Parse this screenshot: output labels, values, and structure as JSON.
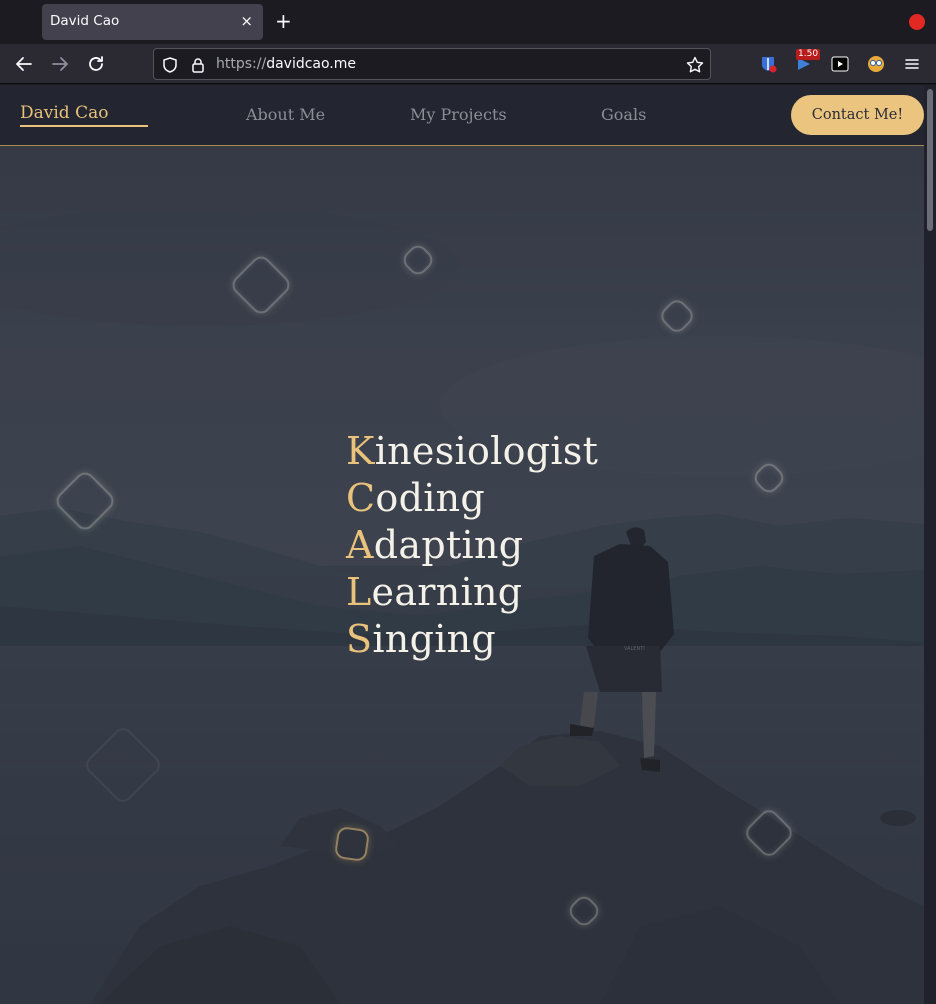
{
  "browser": {
    "tab_title": "David Cao",
    "tab_close": "×",
    "new_tab": "+",
    "url_scheme": "https://",
    "url_host": "davidcao.me",
    "extension_badge": "1.50",
    "icons": [
      "back-icon",
      "forward-icon",
      "reload-icon",
      "shield-icon",
      "lock-icon",
      "star-icon",
      "bitwarden-icon",
      "ublock-icon",
      "youtube-icon",
      "face-icon",
      "menu-icon"
    ]
  },
  "site": {
    "brand": "David Cao",
    "nav": [
      "About Me",
      "My Projects",
      "Goals"
    ],
    "contact_label": "Contact Me!"
  },
  "hero": {
    "words": [
      {
        "initial": "K",
        "rest": "inesiologist"
      },
      {
        "initial": "C",
        "rest": "oding"
      },
      {
        "initial": "A",
        "rest": "dapting"
      },
      {
        "initial": "L",
        "rest": "earning"
      },
      {
        "initial": "S",
        "rest": "inging"
      }
    ],
    "shirt_text": "VALENTI"
  },
  "colors": {
    "accent": "#e9c27b",
    "header_bg": "#232630",
    "hero_text": "#f4f1e9",
    "nav_text": "#8c8e96"
  }
}
